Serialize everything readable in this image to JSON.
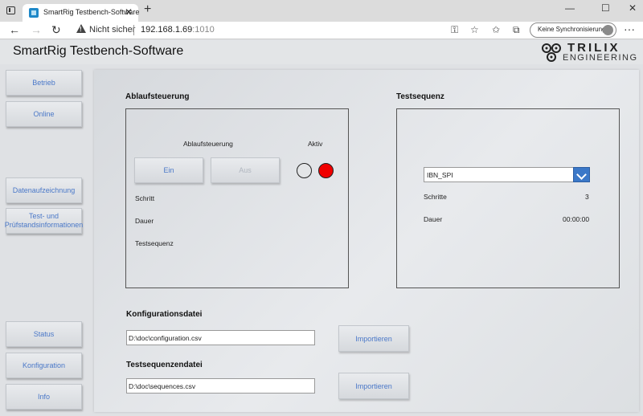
{
  "browser": {
    "tab_title": "SmartRig Testbench-Software",
    "tab_close": "✕",
    "new_tab": "+",
    "window_controls": [
      "—",
      "☐",
      "✕"
    ],
    "security_text": "Nicht sicher",
    "url_host": "192.168.1.69",
    "url_port": ":1010",
    "sync_label": "Keine Synchronisierung",
    "more": "···"
  },
  "app": {
    "title": "SmartRig Testbench-Software",
    "logo_line1": "TRILIX",
    "logo_line2": "ENGINEERING"
  },
  "sidebar": {
    "items": [
      {
        "label": "Betrieb"
      },
      {
        "label": "Online"
      },
      {
        "label": "Datenaufzeichnung"
      },
      {
        "label": "Test- und Prüfstandsinformationen"
      },
      {
        "label": "Status"
      },
      {
        "label": "Konfiguration"
      },
      {
        "label": "Info"
      }
    ]
  },
  "control": {
    "section_title": "Ablaufsteuerung",
    "header": "Ablaufsteuerung",
    "active_header": "Aktiv",
    "on_label": "Ein",
    "off_label": "Aus",
    "step_label": "Schritt",
    "duration_label": "Dauer",
    "sequence_label": "Testsequenz",
    "lamp_status": [
      "off",
      "on"
    ],
    "lamp_colors": {
      "off": "#e3e5e7",
      "on": "#f00000"
    }
  },
  "sequence": {
    "section_title": "Testsequenz",
    "selected": "IBN_SPI",
    "steps_label": "Schritte",
    "steps_value": "3",
    "duration_label": "Dauer",
    "duration_value": "00:00:00"
  },
  "config_file": {
    "title": "Konfigurationsdatei",
    "path": "D:\\doc\\configuration.csv",
    "import_label": "Importieren"
  },
  "sequence_file": {
    "title": "Testsequenzendatei",
    "path": "D:\\doc\\sequences.csv",
    "import_label": "Importieren"
  },
  "colors": {
    "accent": "#4a78c8",
    "dropdown": "#3b78c8"
  }
}
